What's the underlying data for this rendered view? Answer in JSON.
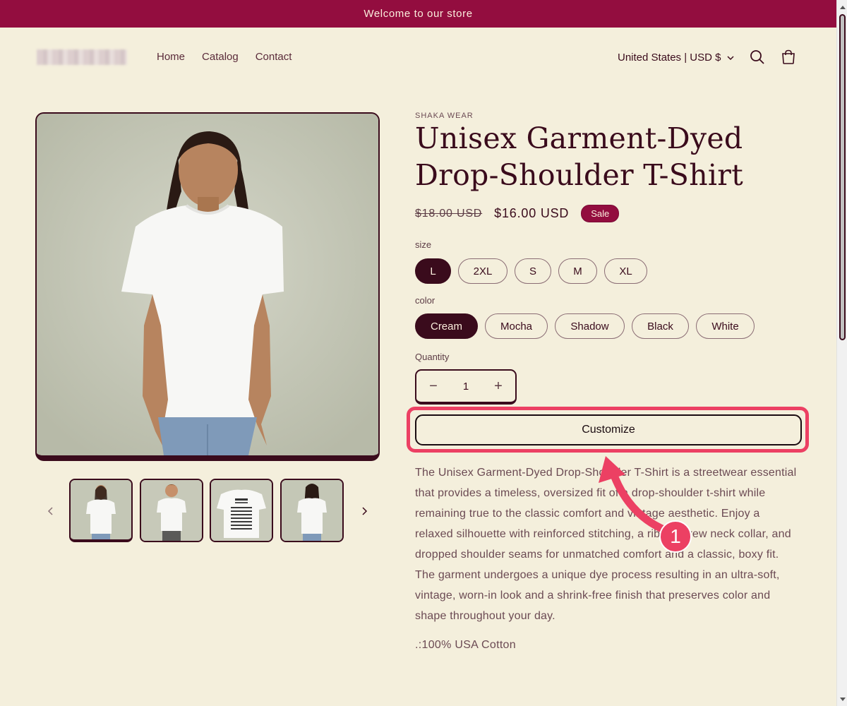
{
  "announcement": {
    "text": "Welcome to our store"
  },
  "header": {
    "nav": [
      "Home",
      "Catalog",
      "Contact"
    ],
    "locale": "United States | USD $",
    "icons": [
      "search-icon",
      "cart-icon",
      "chevron-down-icon"
    ]
  },
  "product": {
    "vendor": "SHAKA WEAR",
    "title": "Unisex Garment-Dyed Drop-Shoulder T-Shirt",
    "price_old": "$18.00 USD",
    "price_new": "$16.00 USD",
    "badge": "Sale",
    "size_label": "size",
    "sizes": [
      "L",
      "2XL",
      "S",
      "M",
      "XL"
    ],
    "size_selected": "L",
    "color_label": "color",
    "colors": [
      "Cream",
      "Mocha",
      "Shadow",
      "Black",
      "White"
    ],
    "color_selected": "Cream",
    "quantity_label": "Quantity",
    "quantity": "1",
    "minus": "−",
    "plus": "+",
    "customize_label": "Customize",
    "description": "The Unisex Garment-Dyed Drop-Shoulder T-Shirt is a streetwear essential that provides a timeless, oversized fit of a drop-shoulder t-shirt while remaining true to the classic comfort and vintage aesthetic. Enjoy a relaxed silhouette with reinforced stitching, a ribbed crew neck collar, and dropped shoulder seams for unmatched comfort and a classic, boxy fit. The garment undergoes a unique dye process resulting in an ultra-soft, vintage, worn-in look and a shrink-free finish that preserves color and shape throughout your day.",
    "material": ".:100% USA Cotton"
  },
  "annotation": {
    "step": "1"
  },
  "colors": {
    "brand": "#930d3f",
    "ink": "#3a0b1c",
    "background": "#f4efdc",
    "highlight": "#ec4063"
  }
}
